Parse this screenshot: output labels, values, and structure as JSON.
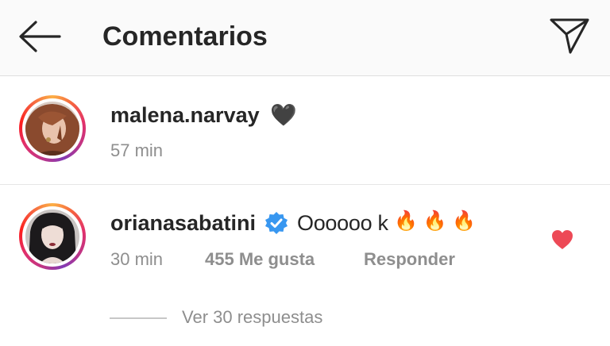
{
  "header": {
    "title": "Comentarios",
    "back_icon": "arrow-left-icon",
    "share_icon": "paper-plane-icon"
  },
  "comments": [
    {
      "username": "malena.narvay",
      "emoji": "🖤",
      "time": "57 min",
      "avatar_icon": "avatar-redhair"
    },
    {
      "username": "orianasabatini",
      "verified_icon": "verified-badge-icon",
      "text": "Oooooo k",
      "emojis": "🔥 🔥 🔥",
      "time": "30 min",
      "likes": "455 Me gusta",
      "reply_label": "Responder",
      "liked": true,
      "avatar_icon": "avatar-darkhair"
    }
  ],
  "replies": {
    "label": "Ver 30 respuestas"
  },
  "colors": {
    "like_red": "#ed4956",
    "verified_blue": "#3897f0",
    "meta_gray": "#8e8e8e",
    "text": "#262626"
  }
}
